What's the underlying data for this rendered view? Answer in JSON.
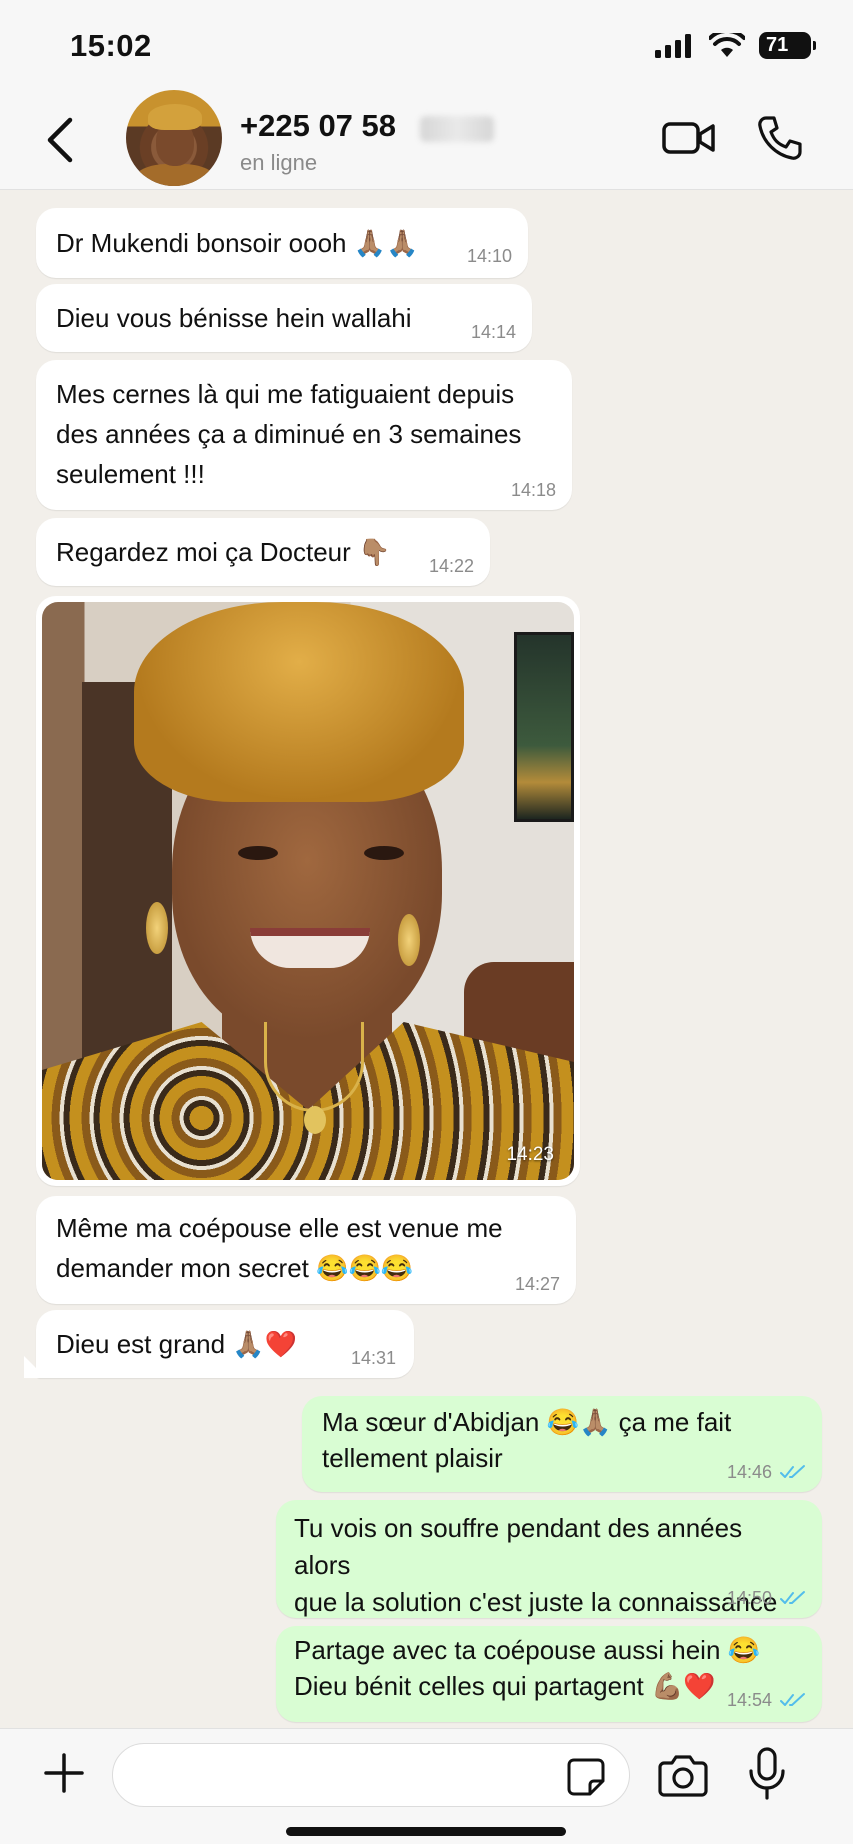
{
  "status_bar": {
    "time": "15:02",
    "battery": "71",
    "icons": [
      "signal-icon",
      "wifi-icon",
      "battery-icon"
    ]
  },
  "header": {
    "contact_name": "+225 07 58",
    "contact_status": "en ligne",
    "icons": [
      "back-chevron-icon",
      "video-call-icon",
      "phone-call-icon"
    ]
  },
  "messages": [
    {
      "direction": "in",
      "text": "Dr Mukendi bonsoir oooh 🙏🏽🙏🏽",
      "time": "14:10"
    },
    {
      "direction": "in",
      "text": "Dieu vous bénisse hein wallahi",
      "time": "14:14"
    },
    {
      "direction": "in",
      "lines": [
        "Mes cernes là qui me fatiguaient depuis",
        "des années ça a diminué en 3 semaines",
        "seulement !!!"
      ],
      "time": "14:18"
    },
    {
      "direction": "in",
      "text": "Regardez moi ça Docteur 👇🏽",
      "time": "14:22"
    },
    {
      "direction": "in",
      "type": "image",
      "time": "14:23"
    },
    {
      "direction": "in",
      "lines": [
        "Même ma coépouse elle est venue me",
        "demander mon secret 😂😂😂"
      ],
      "time": "14:27"
    },
    {
      "direction": "in",
      "text": "Dieu est grand 🙏🏽❤️",
      "time": "14:31"
    },
    {
      "direction": "out",
      "lines": [
        "Ma sœur d'Abidjan 😂🙏🏽 ça me fait",
        "tellement plaisir"
      ],
      "time": "14:46",
      "read": true
    },
    {
      "direction": "out",
      "lines": [
        "Tu vois on souffre pendant des années alors",
        "que la solution c'est juste la connaissance"
      ],
      "time": "14:50",
      "read": true
    },
    {
      "direction": "out",
      "lines": [
        "Partage avec ta coépouse aussi hein 😂",
        "Dieu bénit celles qui partagent 💪🏽❤️"
      ],
      "time": "14:54",
      "read": true
    }
  ],
  "composer": {
    "icons": [
      "plus-icon",
      "sticker-icon",
      "camera-icon",
      "microphone-icon"
    ]
  },
  "colors": {
    "incoming_bubble": "#ffffff",
    "outgoing_bubble": "#d9fdd3",
    "read_ticks": "#53bdeb",
    "chat_background": "#f2efea"
  }
}
